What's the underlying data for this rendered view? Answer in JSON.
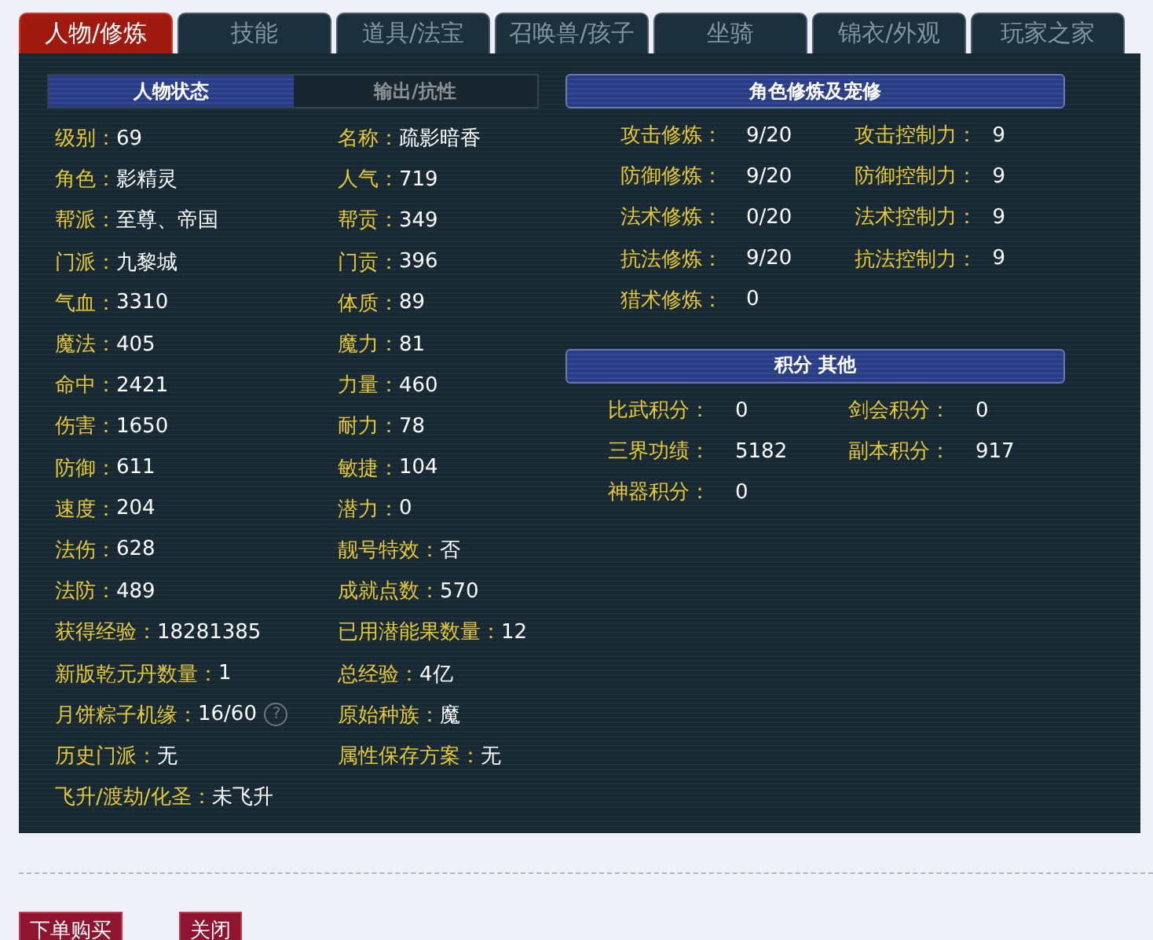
{
  "tabs": [
    {
      "label": "人物/修炼",
      "selected": true
    },
    {
      "label": "技能",
      "selected": false
    },
    {
      "label": "道具/法宝",
      "selected": false
    },
    {
      "label": "召唤兽/孩子",
      "selected": false
    },
    {
      "label": "坐骑",
      "selected": false
    },
    {
      "label": "锦衣/外观",
      "selected": false
    },
    {
      "label": "玩家之家",
      "selected": false
    }
  ],
  "subtabs": [
    {
      "label": "人物状态",
      "selected": true
    },
    {
      "label": "输出/抗性",
      "selected": false
    }
  ],
  "attributes": [
    [
      {
        "label": "级别：",
        "value": "69"
      },
      {
        "label": "名称：",
        "value": "疏影暗香"
      }
    ],
    [
      {
        "label": "角色：",
        "value": "影精灵"
      },
      {
        "label": "人气：",
        "value": "719"
      }
    ],
    [
      {
        "label": "帮派：",
        "value": "至尊、帝国"
      },
      {
        "label": "帮贡：",
        "value": "349"
      }
    ],
    [
      {
        "label": "门派：",
        "value": "九黎城"
      },
      {
        "label": "门贡：",
        "value": "396"
      }
    ],
    [
      {
        "label": "气血：",
        "value": "3310"
      },
      {
        "label": "体质：",
        "value": "89"
      }
    ],
    [
      {
        "label": "魔法：",
        "value": "405"
      },
      {
        "label": "魔力：",
        "value": "81"
      }
    ],
    [
      {
        "label": "命中：",
        "value": "2421"
      },
      {
        "label": "力量：",
        "value": "460"
      }
    ],
    [
      {
        "label": "伤害：",
        "value": "1650"
      },
      {
        "label": "耐力：",
        "value": "78"
      }
    ],
    [
      {
        "label": "防御：",
        "value": "611"
      },
      {
        "label": "敏捷：",
        "value": "104"
      }
    ],
    [
      {
        "label": "速度：",
        "value": "204"
      },
      {
        "label": "潜力：",
        "value": "0"
      }
    ],
    [
      {
        "label": "法伤：",
        "value": "628"
      },
      {
        "label": "靓号特效：",
        "value": "否"
      }
    ],
    [
      {
        "label": "法防：",
        "value": "489"
      },
      {
        "label": "成就点数：",
        "value": "570"
      }
    ],
    [
      {
        "label": "获得经验：",
        "value": "18281385"
      },
      {
        "label": "已用潜能果数量：",
        "value": "12"
      }
    ],
    [
      {
        "label": "新版乾元丹数量：",
        "value": "1"
      },
      {
        "label": "总经验：",
        "value": "4亿"
      }
    ],
    [
      {
        "label": "月饼粽子机缘：",
        "value": "16/60",
        "hint": "?"
      },
      {
        "label": "原始种族：",
        "value": "魔"
      }
    ],
    [
      {
        "label": "历史门派：",
        "value": "无"
      },
      {
        "label": "属性保存方案：",
        "value": "无"
      }
    ],
    [
      {
        "label": "飞升/渡劫/化圣：",
        "value": "未飞升"
      }
    ]
  ],
  "cultivation": {
    "title": "角色修炼及宠修",
    "rows": [
      [
        {
          "label": "攻击修炼：",
          "value": "9/20"
        },
        {
          "label": "攻击控制力：",
          "value": "9"
        }
      ],
      [
        {
          "label": "防御修炼：",
          "value": "9/20"
        },
        {
          "label": "防御控制力：",
          "value": "9"
        }
      ],
      [
        {
          "label": "法术修炼：",
          "value": "0/20"
        },
        {
          "label": "法术控制力：",
          "value": "9"
        }
      ],
      [
        {
          "label": "抗法修炼：",
          "value": "9/20"
        },
        {
          "label": "抗法控制力：",
          "value": "9"
        }
      ],
      [
        {
          "label": "猎术修炼：",
          "value": "0"
        }
      ]
    ]
  },
  "scores": {
    "title": "积分 其他",
    "rows": [
      [
        {
          "label": "比武积分：",
          "value": "0"
        },
        {
          "label": "剑会积分：",
          "value": "0"
        }
      ],
      [
        {
          "label": "三界功绩：",
          "value": "5182"
        },
        {
          "label": "副本积分：",
          "value": "917"
        }
      ],
      [
        {
          "label": "神器积分：",
          "value": "0"
        }
      ]
    ]
  },
  "buttons": [
    "下单购买",
    "关闭"
  ]
}
